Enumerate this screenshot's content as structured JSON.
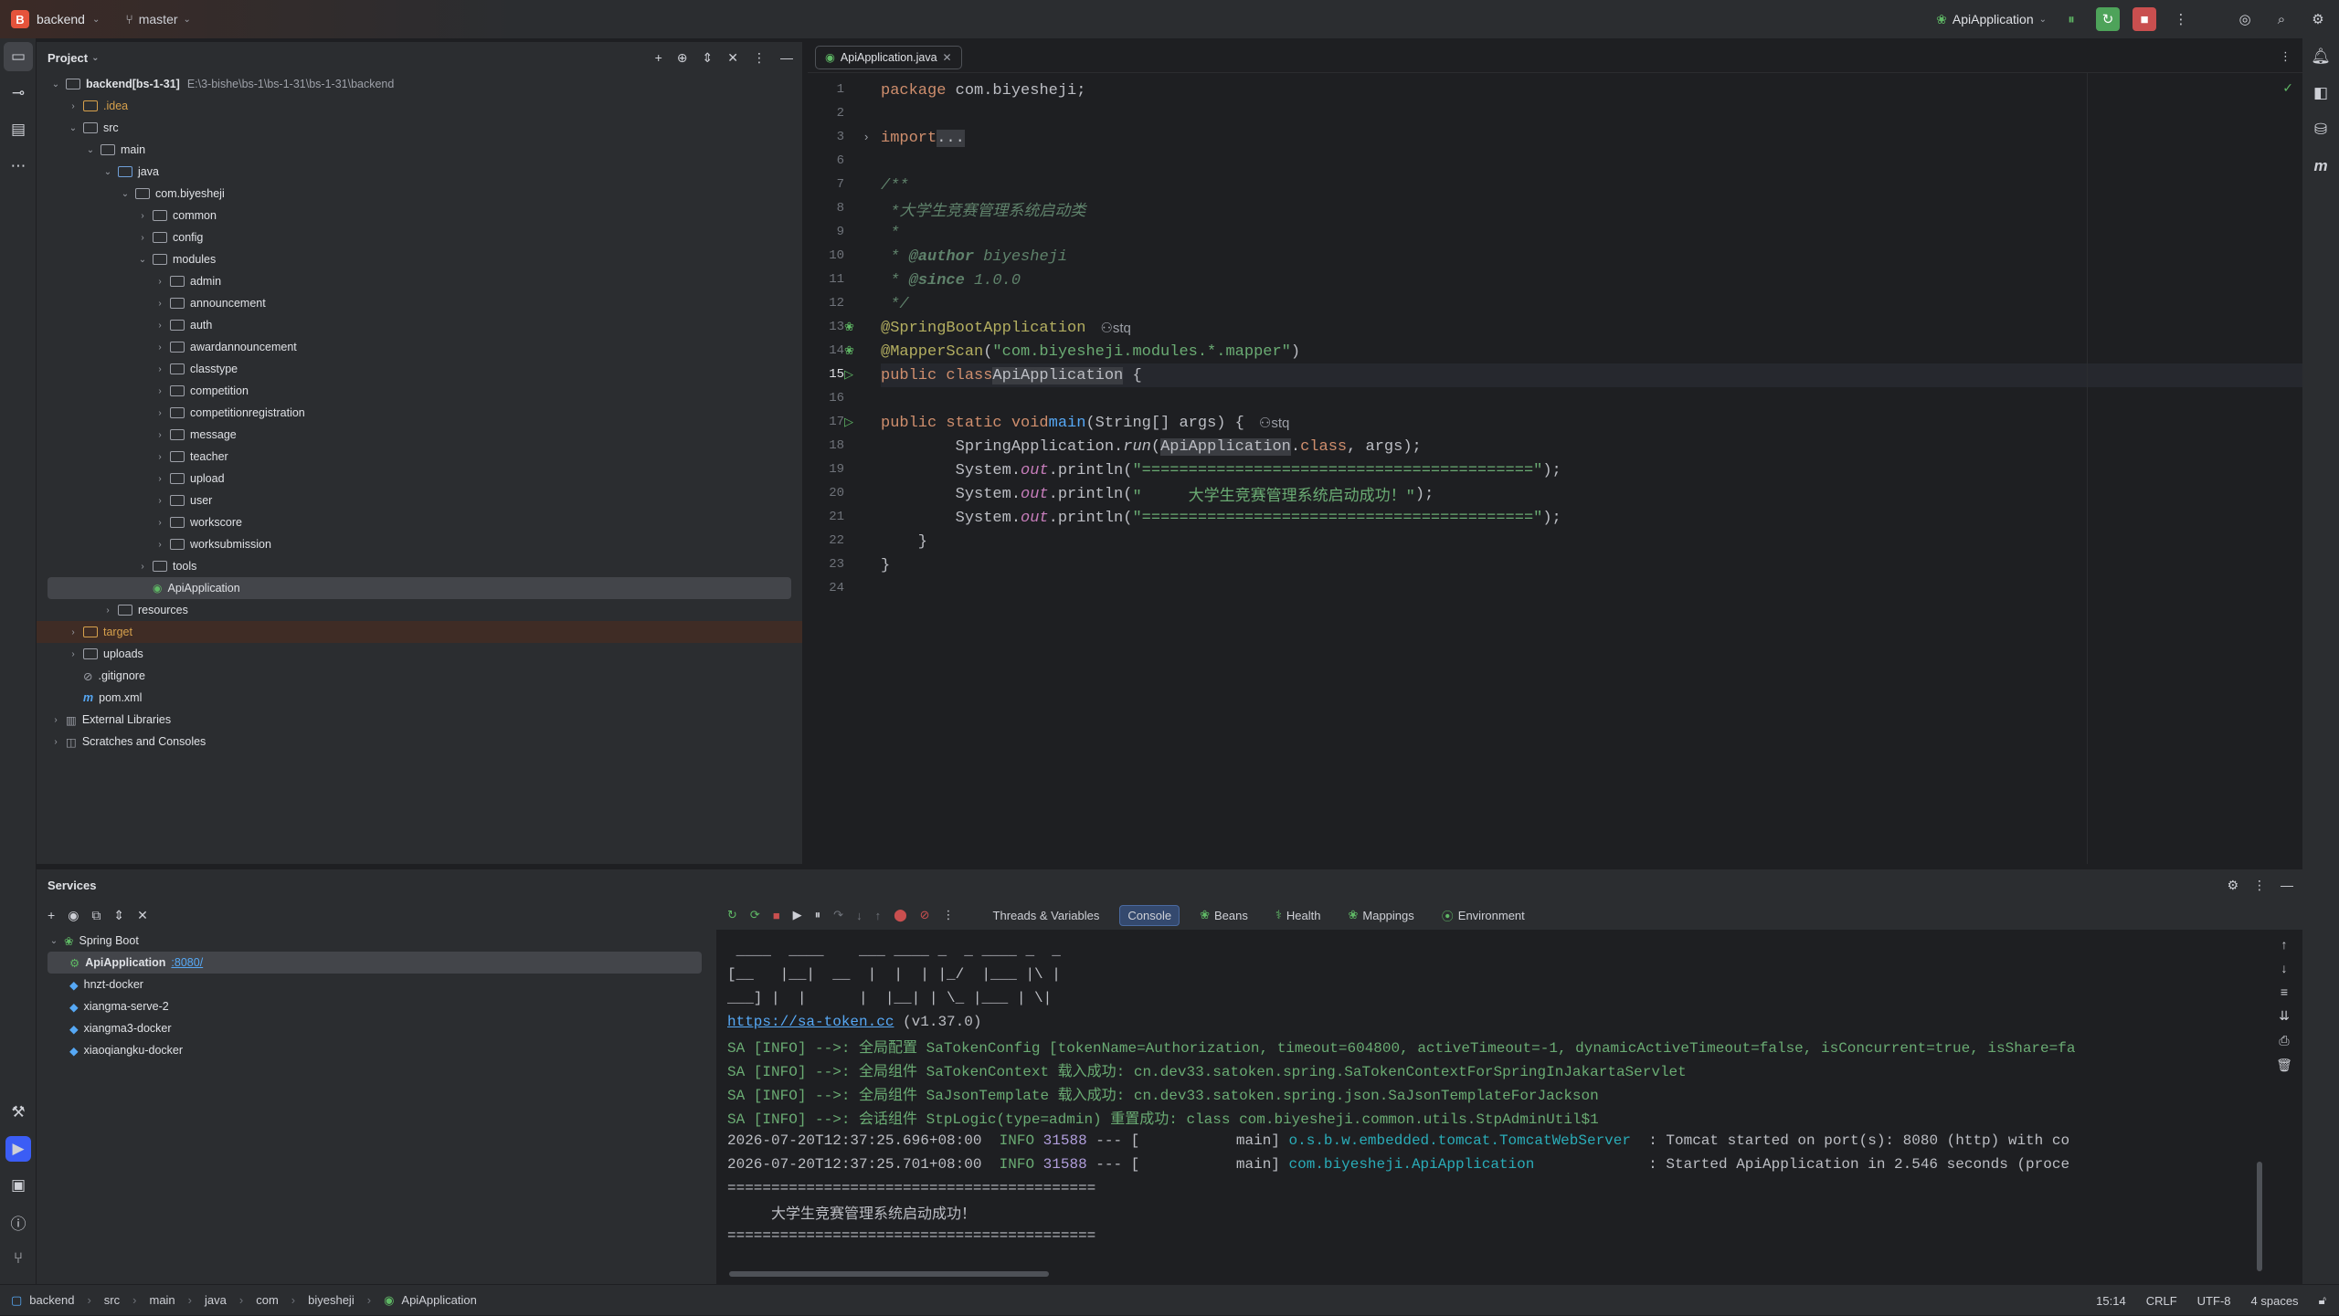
{
  "titlebar": {
    "project_letter": "B",
    "project_name": "backend",
    "branch": "master",
    "run_config": "ApiApplication"
  },
  "project_panel": {
    "title": "Project",
    "tree": [
      {
        "indent": 0,
        "arrow": "v",
        "name": "backend",
        "extra": "[bs-1-31]",
        "path": "E:\\3-bishe\\bs-1\\bs-1-31\\bs-1-31\\backend",
        "kind": "module"
      },
      {
        "indent": 1,
        "arrow": ">",
        "name": ".idea",
        "kind": "folder",
        "color": "orange"
      },
      {
        "indent": 1,
        "arrow": "v",
        "name": "src",
        "kind": "folder"
      },
      {
        "indent": 2,
        "arrow": "v",
        "name": "main",
        "kind": "folder"
      },
      {
        "indent": 3,
        "arrow": "v",
        "name": "java",
        "kind": "src"
      },
      {
        "indent": 4,
        "arrow": "v",
        "name": "com.biyesheji",
        "kind": "folder"
      },
      {
        "indent": 5,
        "arrow": ">",
        "name": "common",
        "kind": "folder"
      },
      {
        "indent": 5,
        "arrow": ">",
        "name": "config",
        "kind": "folder"
      },
      {
        "indent": 5,
        "arrow": "v",
        "name": "modules",
        "kind": "folder"
      },
      {
        "indent": 6,
        "arrow": ">",
        "name": "admin",
        "kind": "folder"
      },
      {
        "indent": 6,
        "arrow": ">",
        "name": "announcement",
        "kind": "folder"
      },
      {
        "indent": 6,
        "arrow": ">",
        "name": "auth",
        "kind": "folder"
      },
      {
        "indent": 6,
        "arrow": ">",
        "name": "awardannouncement",
        "kind": "folder"
      },
      {
        "indent": 6,
        "arrow": ">",
        "name": "classtype",
        "kind": "folder"
      },
      {
        "indent": 6,
        "arrow": ">",
        "name": "competition",
        "kind": "folder"
      },
      {
        "indent": 6,
        "arrow": ">",
        "name": "competitionregistration",
        "kind": "folder"
      },
      {
        "indent": 6,
        "arrow": ">",
        "name": "message",
        "kind": "folder"
      },
      {
        "indent": 6,
        "arrow": ">",
        "name": "teacher",
        "kind": "folder"
      },
      {
        "indent": 6,
        "arrow": ">",
        "name": "upload",
        "kind": "folder"
      },
      {
        "indent": 6,
        "arrow": ">",
        "name": "user",
        "kind": "folder"
      },
      {
        "indent": 6,
        "arrow": ">",
        "name": "workscore",
        "kind": "folder"
      },
      {
        "indent": 6,
        "arrow": ">",
        "name": "worksubmission",
        "kind": "folder"
      },
      {
        "indent": 5,
        "arrow": ">",
        "name": "tools",
        "kind": "folder"
      },
      {
        "indent": 5,
        "arrow": "",
        "name": "ApiApplication",
        "kind": "springclass",
        "selected": true
      },
      {
        "indent": 3,
        "arrow": ">",
        "name": "resources",
        "kind": "folder"
      },
      {
        "indent": 1,
        "arrow": ">",
        "name": "target",
        "kind": "folder",
        "color": "orange",
        "highlight": true
      },
      {
        "indent": 1,
        "arrow": ">",
        "name": "uploads",
        "kind": "folder"
      },
      {
        "indent": 1,
        "arrow": "",
        "name": ".gitignore",
        "kind": "file"
      },
      {
        "indent": 1,
        "arrow": "",
        "name": "pom.xml",
        "kind": "maven"
      },
      {
        "indent": 0,
        "arrow": ">",
        "name": "External Libraries",
        "kind": "lib"
      },
      {
        "indent": 0,
        "arrow": ">",
        "name": "Scratches and Consoles",
        "kind": "scratch"
      }
    ]
  },
  "editor": {
    "tab_label": "ApiApplication.java",
    "lines": [
      {
        "n": "1",
        "html": "<span class='kw'>package</span> com.biyesheji;"
      },
      {
        "n": "2",
        "html": ""
      },
      {
        "n": "3",
        "html": "<span class='kw'>import</span> <span class='hl'>...</span>"
      },
      {
        "n": "6",
        "html": ""
      },
      {
        "n": "7",
        "html": "<span class='doc'>/**</span>"
      },
      {
        "n": "8",
        "html": "<span class='doc'> *大学生竞赛管理系统启动类</span>"
      },
      {
        "n": "9",
        "html": "<span class='doc'> *</span>"
      },
      {
        "n": "10",
        "html": "<span class='doc'> * <b>@author</b> biyesheji</span>"
      },
      {
        "n": "11",
        "html": "<span class='doc'> * <b>@since</b> 1.0.0</span>"
      },
      {
        "n": "12",
        "html": "<span class='doc'> */</span>"
      },
      {
        "n": "13",
        "html": "<span class='ann'>@SpringBootApplication</span>"
      },
      {
        "n": "14",
        "html": "<span class='ann'>@MapperScan</span>(<span class='str'>\"com.biyesheji.modules.*.mapper\"</span>)"
      },
      {
        "n": "15",
        "html": "<span class='kw'>public class</span> <span class='hl'>ApiApplication</span> {"
      },
      {
        "n": "16",
        "html": ""
      },
      {
        "n": "17",
        "html": "    <span class='kw'>public static void</span> <span class='fn'>main</span>(String[] args) {"
      },
      {
        "n": "18",
        "html": "        SpringApplication.<i>run</i>(<span class='hl'>ApiApplication</span>.<span class='kw'>class</span>, args);"
      },
      {
        "n": "19",
        "html": "        System.<span class='fld'>out</span>.println(<span class='str'>\"==========================================\"</span>);"
      },
      {
        "n": "20",
        "html": "        System.<span class='fld'>out</span>.println(<span class='str'>\"     大学生竞赛管理系统启动成功！\"</span>);"
      },
      {
        "n": "21",
        "html": "        System.<span class='fld'>out</span>.println(<span class='str'>\"==========================================\"</span>);"
      },
      {
        "n": "22",
        "html": "    }"
      },
      {
        "n": "23",
        "html": "}"
      },
      {
        "n": "24",
        "html": ""
      }
    ],
    "author_hint": "stq"
  },
  "services": {
    "title": "Services",
    "tree": [
      {
        "name": "Spring Boot",
        "arrow": "v",
        "indent": 0
      },
      {
        "name": "ApiApplication",
        "port": ":8080/",
        "indent": 1,
        "selected": true
      },
      {
        "name": "hnzt-docker",
        "indent": 1
      },
      {
        "name": "xiangma-serve-2",
        "indent": 1
      },
      {
        "name": "xiangma3-docker",
        "indent": 1
      },
      {
        "name": "xiaoqiangku-docker",
        "indent": 1
      }
    ],
    "tabs": [
      "Threads & Variables",
      "Console",
      "Beans",
      "Health",
      "Mappings",
      "Environment"
    ],
    "active_tab": "Console",
    "console_lines": [
      {
        "cls": "grey",
        "text": " ____  ____    ___ ____ _  _ ____ _  _"
      },
      {
        "cls": "grey",
        "text": "[__   |__|  __  |  |  | |_/  |___ |\\ |"
      },
      {
        "cls": "grey",
        "text": "___] |  |      |  |__| | \\_ |___ | \\|"
      },
      {
        "cls": "mixed",
        "link": "https://sa-token.cc",
        "text": " (v1.37.0)"
      },
      {
        "cls": "sa",
        "text": "SA [INFO] -->: 全局配置 SaTokenConfig [tokenName=Authorization, timeout=604800, activeTimeout=-1, dynamicActiveTimeout=false, isConcurrent=true, isShare=fa"
      },
      {
        "cls": "sa",
        "text": "SA [INFO] -->: 全局组件 SaTokenContext 载入成功: cn.dev33.satoken.spring.SaTokenContextForSpringInJakartaServlet"
      },
      {
        "cls": "sa",
        "text": "SA [INFO] -->: 全局组件 SaJsonTemplate 载入成功: cn.dev33.satoken.spring.json.SaJsonTemplateForJackson"
      },
      {
        "cls": "sa",
        "text": "SA [INFO] -->: 会话组件 StpLogic(type=admin) 重置成功: class com.biyesheji.common.utils.StpAdminUtil$1"
      },
      {
        "cls": "log",
        "time": "2026-07-20T12:37:25.696+08:00",
        "level": "INFO",
        "pid": "31588",
        "mid": " --- [           main] ",
        "logger": "o.s.b.w.embedded.tomcat.TomcatWebServer",
        "msg": "  : Tomcat started on port(s): 8080 (http) with co"
      },
      {
        "cls": "log",
        "time": "2026-07-20T12:37:25.701+08:00",
        "level": "INFO",
        "pid": "31588",
        "mid": " --- [           main] ",
        "logger": "com.biyesheji.ApiApplication",
        "msg": "             : Started ApiApplication in 2.546 seconds (proce"
      },
      {
        "cls": "grey",
        "text": "=========================================="
      },
      {
        "cls": "grey",
        "text": "     大学生竞赛管理系统启动成功！"
      },
      {
        "cls": "grey",
        "text": "=========================================="
      }
    ]
  },
  "statusbar": {
    "crumbs": [
      "backend",
      "src",
      "main",
      "java",
      "com",
      "biyesheji",
      "ApiApplication"
    ],
    "position": "15:14",
    "line_sep": "CRLF",
    "encoding": "UTF-8",
    "indent": "4 spaces"
  }
}
